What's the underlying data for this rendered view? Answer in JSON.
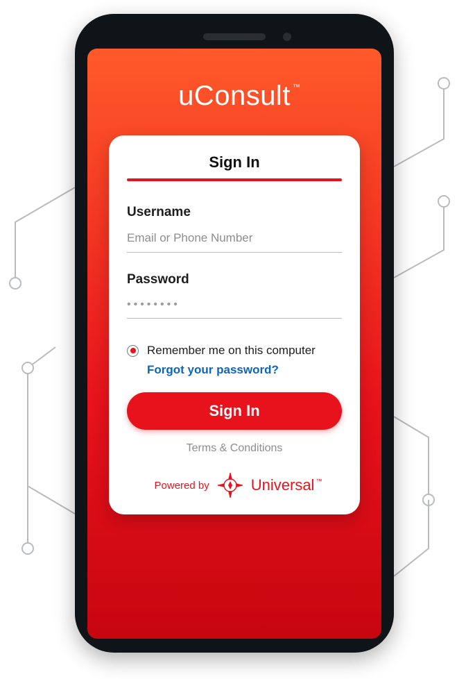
{
  "brand": {
    "name": "uConsult",
    "tm": "™"
  },
  "card": {
    "title": "Sign In",
    "username": {
      "label": "Username",
      "placeholder": "Email or Phone Number"
    },
    "password": {
      "label": "Password",
      "mask": "••••••••"
    },
    "remember": "Remember me on this computer",
    "forgot": "Forgot your password?",
    "button": "Sign In",
    "terms": "Terms & Conditions",
    "powered_by": "Powered by",
    "powered_name": "Universal",
    "powered_tm": "™"
  },
  "colors": {
    "accent": "#e8121c",
    "link": "#0a66bd"
  }
}
